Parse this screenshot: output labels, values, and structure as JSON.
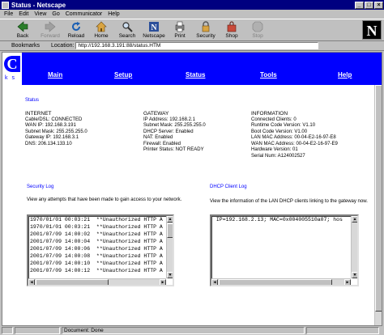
{
  "window": {
    "title": "Status - Netscape"
  },
  "menu": [
    "File",
    "Edit",
    "View",
    "Go",
    "Communicator",
    "Help"
  ],
  "toolbar": {
    "buttons": [
      {
        "label": "Back"
      },
      {
        "label": "Forward"
      },
      {
        "label": "Reload"
      },
      {
        "label": "Home"
      },
      {
        "label": "Search"
      },
      {
        "label": "Netscape"
      },
      {
        "label": "Print"
      },
      {
        "label": "Security"
      },
      {
        "label": "Shop"
      },
      {
        "label": "Stop"
      }
    ]
  },
  "location": {
    "bookmarks_label": "Bookmarks",
    "location_label": "Location:",
    "url": "http://192.168.3.191:88/status.HTM"
  },
  "nav": {
    "logo_text": "ks",
    "links": [
      "Main",
      "Setup",
      "Status",
      "Tools",
      "Help"
    ]
  },
  "status_title": "Status",
  "internet": {
    "heading": "INTERNET",
    "lines": [
      "Cable/DSL:  CONNECTED",
      "WAN IP:  192.168.3.191",
      "Subnet Mask:  255.255.255.0",
      "Gateway IP:  192.168.3.1",
      "DNS:  206.134.133.10"
    ]
  },
  "gateway": {
    "heading": "GATEWAY",
    "lines": [
      "IP Address:  192.168.2.1",
      "Subnet Mask:  255.255.255.0",
      "DHCP Server:  Enabled",
      "NAT:  Enabled",
      "Firewall:  Enabled",
      "Printer Status:  NOT READY"
    ]
  },
  "information": {
    "heading": "INFORMATION",
    "lines": [
      "Connected Clients:  0",
      "Runtime Code Version:  V1.10",
      "Boot Code Version:  V1.00",
      "LAN MAC Address:  00-04-E2-16-97-E8",
      "WAN MAC Address:  00-04-E2-16-97-E9",
      "Hardware Version:  01",
      "Serial Num:  A124002527"
    ]
  },
  "security_log": {
    "title": "Security Log",
    "description": "View any attempts that have been made to gain access to your network.",
    "lines": [
      "1970/01/01 00:03:21  **Unauthorized HTTP A",
      "1970/01/01 00:03:21  **Unauthorized HTTP A",
      "2001/07/09 14:00:02  **Unauthorized HTTP A",
      "2001/07/09 14:00:04  **Unauthorized HTTP A",
      "2001/07/09 14:00:06  **Unauthorized HTTP A",
      "2001/07/09 14:00:08  **Unauthorized HTTP A",
      "2001/07/09 14:00:10  **Unauthorized HTTP A",
      "2001/07/09 14:00:12  **Unauthorized HTTP A"
    ]
  },
  "dhcp_log": {
    "title": "DHCP Client Log",
    "description": "View the information of the LAN DHCP clients linking to the gateway now.",
    "lines": [
      " IP=192.168.2.13; MAC=0x004005510a07; hos"
    ]
  },
  "statusbar": {
    "text": "Document: Done"
  }
}
